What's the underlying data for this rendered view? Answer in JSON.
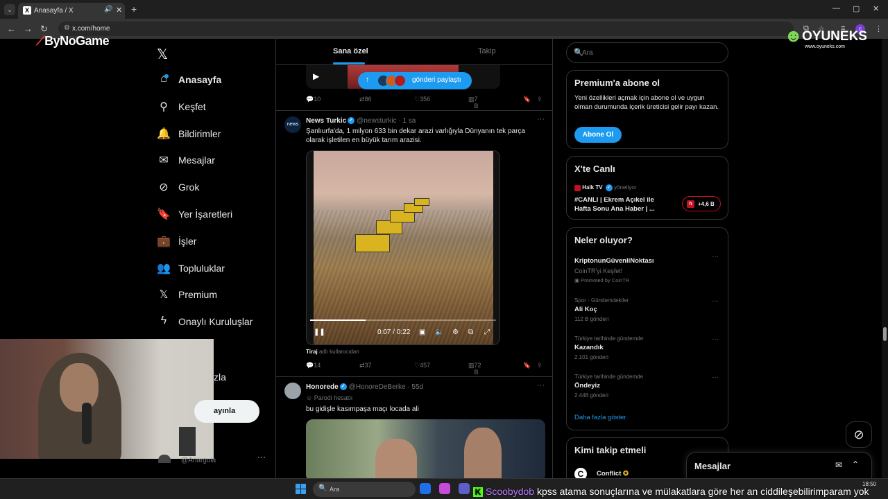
{
  "browser": {
    "tab_title": "Anasayfa / X",
    "tab_favicon": "X",
    "url": "x.com/home",
    "profile_initial": "c"
  },
  "overlays": {
    "bynogame": "ByNoGame",
    "oyuneks_name": "OYUNEKS",
    "oyuneks_url": "www.oyuneks.com"
  },
  "nav": {
    "items": [
      {
        "label": "Anasayfa",
        "icon": "home-icon"
      },
      {
        "label": "Keşfet",
        "icon": "search-icon"
      },
      {
        "label": "Bildirimler",
        "icon": "bell-icon"
      },
      {
        "label": "Mesajlar",
        "icon": "envelope-icon"
      },
      {
        "label": "Grok",
        "icon": "grok-icon"
      },
      {
        "label": "Yer İşaretleri",
        "icon": "bookmark-icon"
      },
      {
        "label": "İşler",
        "icon": "briefcase-icon"
      },
      {
        "label": "Topluluklar",
        "icon": "people-icon"
      },
      {
        "label": "Premium",
        "icon": "x-icon"
      },
      {
        "label": "Onaylı Kuruluşlar",
        "icon": "lightning-icon"
      }
    ],
    "partial_more_label": "zla",
    "post_button": "ayınla",
    "account_handle": "@Anarguia"
  },
  "feed": {
    "tabs": [
      "Sana özel",
      "Takip"
    ],
    "share_pill": "gönderi paylaştı",
    "tweet0_actions": {
      "replies": "10",
      "reposts": "86",
      "likes": "356",
      "views": "7 B"
    },
    "tweets": [
      {
        "name": "News Turkic",
        "handle": "@newsturkic · 1 sa",
        "text": "Şanlıurfa'da, 1 milyon 633 bin dekar arazi varlığıyla Dünyanın tek parça olarak işletilen en büyük tarım arazisi.",
        "video_time": "0:07 / 0:22",
        "video_progress": 0.3,
        "tiraj_name": "Tiraj",
        "tiraj_handle": "adlı kullanıcıdan",
        "actions": {
          "replies": "14",
          "reposts": "37",
          "likes": "457",
          "views": "72 B"
        }
      },
      {
        "name": "Honorede",
        "handle": "@HonoreDeBerke · 55d",
        "label": "Parodi hesabı",
        "text": "bu gidişle kasımpaşa maçı locada ali"
      }
    ]
  },
  "sidebar": {
    "search_placeholder": "Ara",
    "premium": {
      "title": "Premium'a abone ol",
      "body": "Yeni özellikleri açmak için abone ol ve uygun olman durumunda içerik üreticisi gelir payı kazan.",
      "button": "Abone Ol"
    },
    "live": {
      "title": "X'te Canlı",
      "source": "Halk TV",
      "role": "yönetiyor",
      "stream_title": "#CANLI | Ekrem Açıkel ile Hafta Sonu Ana Haber | ...",
      "listeners": "+4,6 B"
    },
    "trends": {
      "title": "Neler oluyor?",
      "items": [
        {
          "category": "",
          "name": "KriptonunGüvenliNoktası",
          "count": "CoinTR'yi Keşfet!",
          "promoted": "Promoted by CoinTR"
        },
        {
          "category": "Spor · Gündemdekiler",
          "name": "Ali Koç",
          "count": "112 B gönderi"
        },
        {
          "category": "Türkiye tarihinde gündemde",
          "name": "Kazandık",
          "count": "2.101 gönderi"
        },
        {
          "category": "Türkiye tarihinde gündemde",
          "name": "Öndeyiz",
          "count": "2.448 gönderi"
        }
      ],
      "show_more": "Daha fazla göster"
    },
    "who_to_follow": {
      "title": "Kimi takip etmeli",
      "first_name": "Conflict"
    }
  },
  "messages_drawer": {
    "title": "Mesajlar"
  },
  "taskbar": {
    "search": "Ara",
    "time": "18:50",
    "marquee_user": "Scoobydob",
    "marquee_text": "kpss atama sonuçlarına ve mülakatlara göre her an ciddileşebilirimparam yok"
  },
  "colors": {
    "accent": "#1d9bf0",
    "background": "#000000",
    "border": "#2f3336",
    "muted_text": "#71767b",
    "live_red": "#c1121f"
  }
}
